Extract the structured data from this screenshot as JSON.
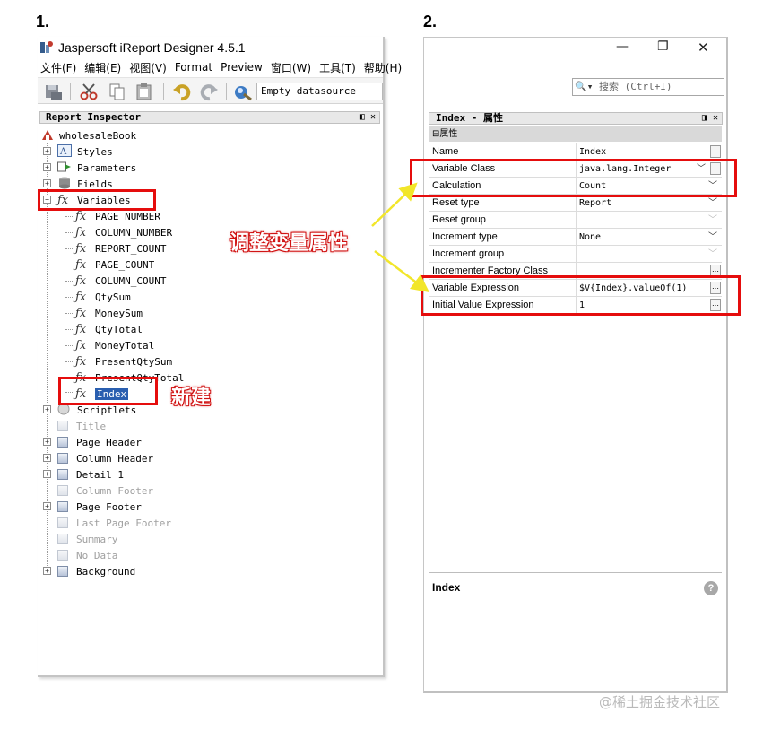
{
  "steps": [
    "1.",
    "2."
  ],
  "left_window": {
    "title": "Jaspersoft iReport Designer 4.5.1",
    "menu": [
      "文件(F)",
      "编辑(E)",
      "视图(V)",
      "Format",
      "Preview",
      "窗口(W)",
      "工具(T)",
      "帮助(H)"
    ],
    "datasource": "Empty datasource",
    "inspector_title": "Report Inspector",
    "report_name": "wholesaleBook",
    "tree_top": [
      "Styles",
      "Parameters",
      "Fields",
      "Variables"
    ],
    "variables": [
      "PAGE_NUMBER",
      "COLUMN_NUMBER",
      "REPORT_COUNT",
      "PAGE_COUNT",
      "COLUMN_COUNT",
      "QtySum",
      "MoneySum",
      "QtyTotal",
      "MoneyTotal",
      "PresentQtySum",
      "PresentQtyTotal",
      "Index"
    ],
    "bands": [
      "Scriptlets",
      "Title",
      "Page Header",
      "Column Header",
      "Detail 1",
      "Column Footer",
      "Page Footer",
      "Last Page Footer",
      "Summary",
      "No Data",
      "Background"
    ]
  },
  "right_window": {
    "search_placeholder": "搜索 (Ctrl+I)",
    "panel_title": "Index - 属性",
    "section": "属性",
    "properties": [
      {
        "name": "Name",
        "value": "Index"
      },
      {
        "name": "Variable Class",
        "value": "java.lang.Integer"
      },
      {
        "name": "Calculation",
        "value": "Count"
      },
      {
        "name": "Reset type",
        "value": "Report"
      },
      {
        "name": "Reset group",
        "value": ""
      },
      {
        "name": "Increment type",
        "value": "None"
      },
      {
        "name": "Increment group",
        "value": ""
      },
      {
        "name": "Incrementer Factory Class",
        "value": ""
      },
      {
        "name": "Variable Expression",
        "value": "$V{Index}.valueOf(1)"
      },
      {
        "name": "Initial Value Expression",
        "value": "1"
      }
    ],
    "description_title": "Index"
  },
  "annotations": {
    "adjust": "调整变量属性",
    "new": "新建"
  },
  "watermark": "@稀土掘金技术社区",
  "colors": {
    "highlight": "#e50d0d",
    "selection": "#2a5fb0"
  }
}
